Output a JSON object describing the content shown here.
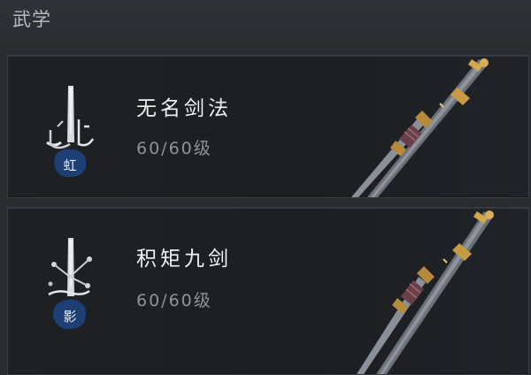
{
  "header": {
    "title": "武学"
  },
  "skills": [
    {
      "name": "无名剑法",
      "level": "60/60级",
      "emblem_glyph": "虹",
      "icon": "sword-emblem-icon"
    },
    {
      "name": "积矩九剑",
      "level": "60/60级",
      "emblem_glyph": "影",
      "icon": "sword-emblem-icon"
    }
  ],
  "colors": {
    "background": "#2a2d30",
    "card": "#1f2124",
    "name_text": "#f2f2f2",
    "level_text": "#8f9396",
    "emblem_ink": "#1e3f73"
  }
}
